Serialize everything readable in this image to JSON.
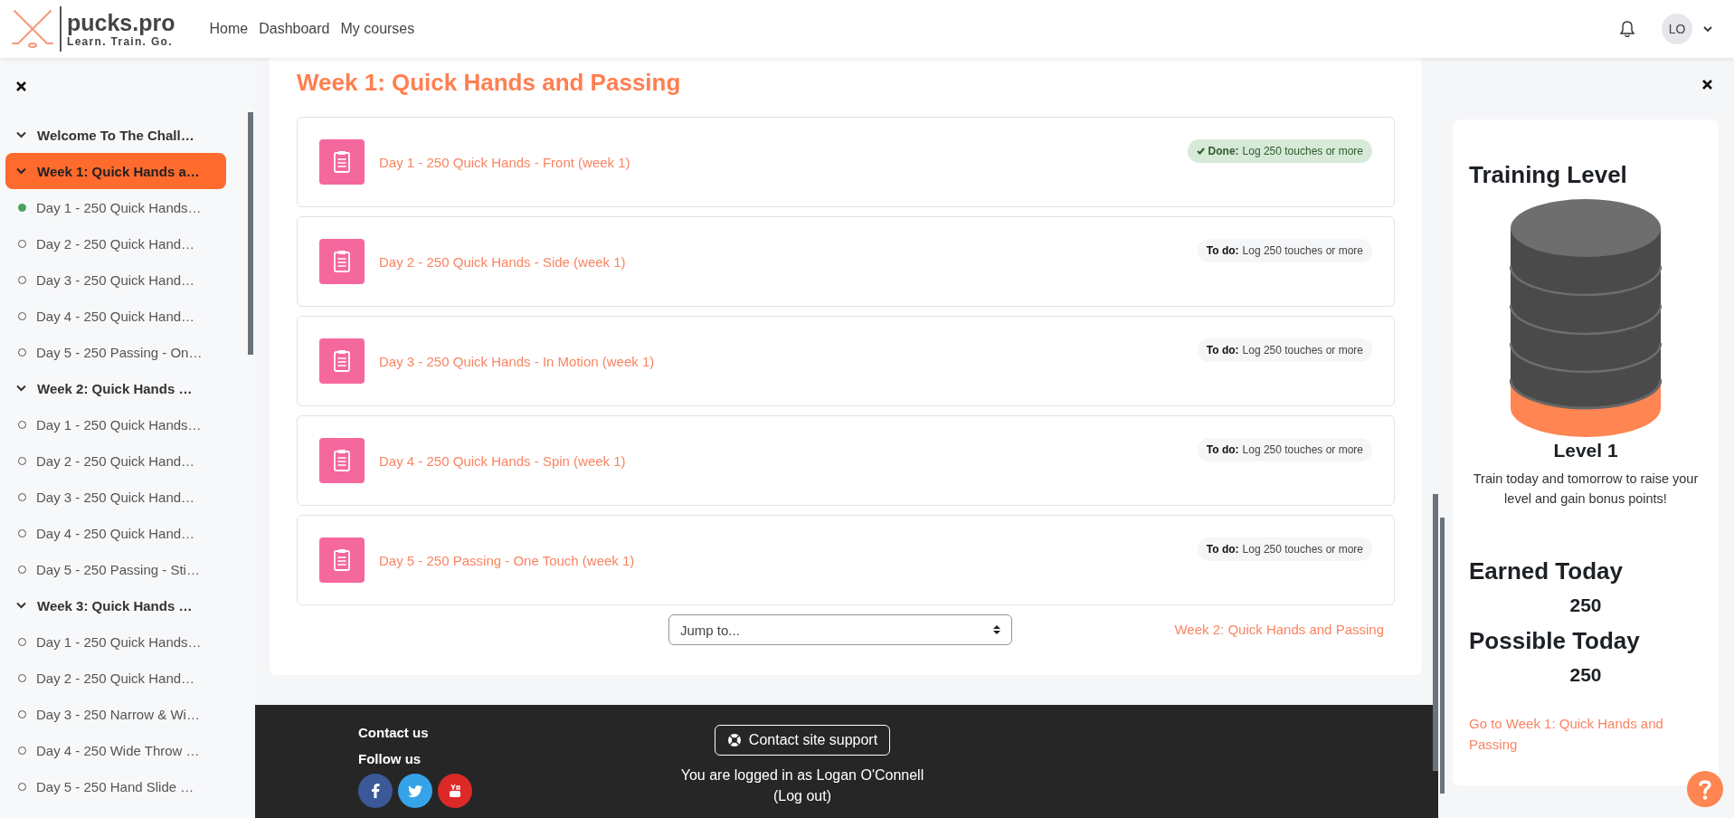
{
  "header": {
    "brand": "pucks.pro",
    "tagline": "Learn. Train. Go.",
    "nav": [
      "Home",
      "Dashboard",
      "My courses"
    ],
    "user_initials": "LO"
  },
  "course_index": {
    "sections": [
      {
        "title": "Welcome To The Chall…",
        "expanded": true,
        "selected": false
      },
      {
        "title": "Week 1: Quick Hands a…",
        "expanded": true,
        "selected": true,
        "items": [
          {
            "label": "Day 1 - 250 Quick Hands…",
            "completed": true
          },
          {
            "label": "Day 2 - 250 Quick Hand…",
            "completed": false
          },
          {
            "label": "Day 3 - 250 Quick Hand…",
            "completed": false
          },
          {
            "label": "Day 4 - 250 Quick Hand…",
            "completed": false
          },
          {
            "label": "Day 5 - 250 Passing - On…",
            "completed": false
          }
        ]
      },
      {
        "title": "Week 2: Quick Hands …",
        "expanded": true,
        "selected": false,
        "items": [
          {
            "label": "Day 1 - 250 Quick Hands…",
            "completed": false
          },
          {
            "label": "Day 2 - 250 Quick Hand…",
            "completed": false
          },
          {
            "label": "Day 3 - 250 Quick Hand…",
            "completed": false
          },
          {
            "label": "Day 4 - 250 Quick Hand…",
            "completed": false
          },
          {
            "label": "Day 5 - 250 Passing - Sti…",
            "completed": false
          }
        ]
      },
      {
        "title": "Week 3: Quick Hands …",
        "expanded": true,
        "selected": false,
        "items": [
          {
            "label": "Day 1 - 250 Quick Hands…",
            "completed": false
          },
          {
            "label": "Day 2 - 250 Quick Hand…",
            "completed": false
          },
          {
            "label": "Day 3 - 250 Narrow & Wi…",
            "completed": false
          },
          {
            "label": "Day 4 - 250 Wide Throw …",
            "completed": false
          },
          {
            "label": "Day 5 - 250 Hand Slide …",
            "completed": false
          }
        ]
      }
    ]
  },
  "section": {
    "title": "Week 1: Quick Hands and Passing",
    "activities": [
      {
        "title": "Day 1 - 250 Quick Hands - Front (week 1)",
        "kind": "done",
        "status_label": "Done:",
        "requirement": "Log 250 touches or more"
      },
      {
        "title": "Day 2 - 250 Quick Hands - Side (week 1)",
        "kind": "todo",
        "status_label": "To do:",
        "requirement": "Log 250 touches or more"
      },
      {
        "title": "Day 3 - 250 Quick Hands - In Motion (week 1)",
        "kind": "todo",
        "status_label": "To do:",
        "requirement": "Log 250 touches or more"
      },
      {
        "title": "Day 4 - 250 Quick Hands - Spin (week 1)",
        "kind": "todo",
        "status_label": "To do:",
        "requirement": "Log 250 touches or more"
      },
      {
        "title": "Day 5 - 250 Passing - One Touch (week 1)",
        "kind": "todo",
        "status_label": "To do:",
        "requirement": "Log 250 touches or more"
      }
    ],
    "jump_to": {
      "value": "Jump to..."
    },
    "next_link": "Week 2: Quick Hands and Passing"
  },
  "footer": {
    "contact": "Contact us",
    "follow": "Follow us",
    "socials": [
      {
        "kind": "facebook"
      },
      {
        "kind": "twitter"
      },
      {
        "kind": "youtube"
      }
    ],
    "support_button": "Contact site support",
    "login_text": "You are logged in as Logan O'Connell",
    "logout_link": "(Log out)"
  },
  "training_panel": {
    "title": "Training Level",
    "level_label": "Level 1",
    "description": "Train today and tomorrow to raise your level and gain bonus points!",
    "earned_title": "Earned Today",
    "earned_value": "250",
    "possible_title": "Possible Today",
    "possible_value": "250",
    "link": "Go to Week 1: Quick Hands and Passing"
  }
}
